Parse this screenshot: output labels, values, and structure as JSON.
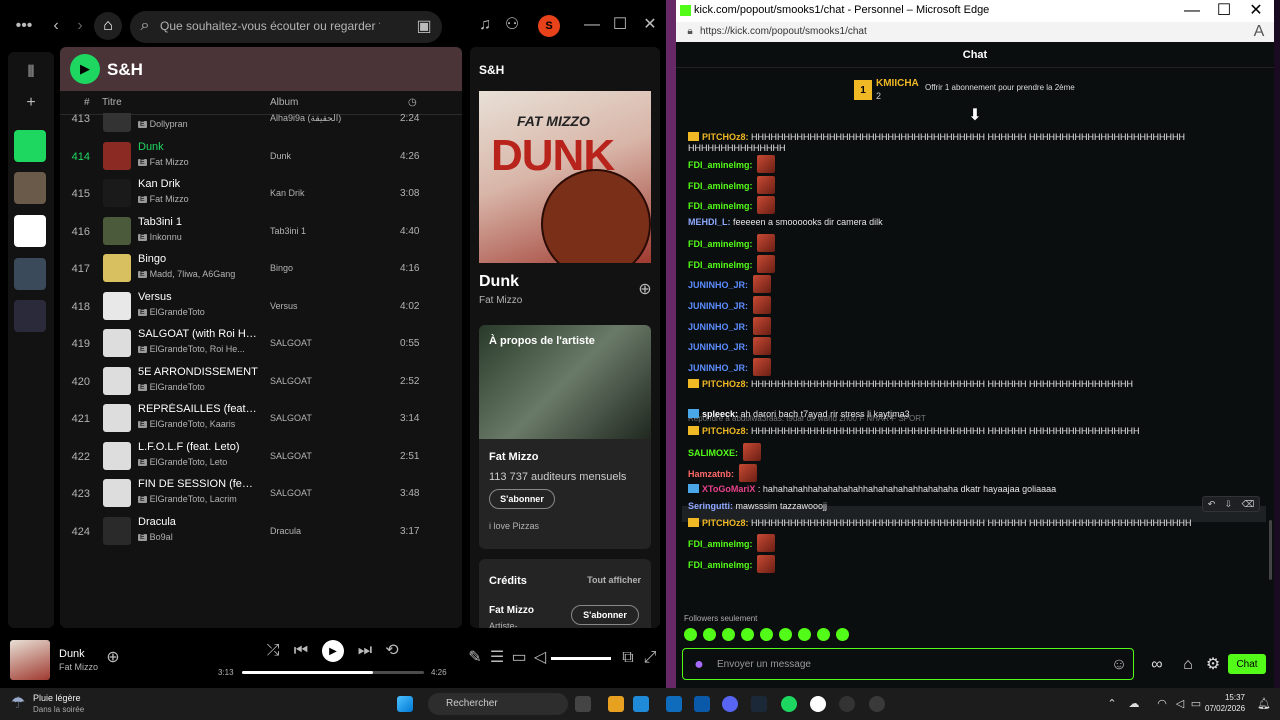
{
  "spotify": {
    "search_placeholder": "Que souhaitez-vous écouter ou regarder ?",
    "avatar_letter": "S",
    "playlist_name": "S&H",
    "columns": {
      "num": "#",
      "title": "Titre",
      "album": "Album"
    },
    "tracks": [
      {
        "num": "413",
        "title": "",
        "artist": "Dollypran",
        "album": "Alha9i9a (الحقيقة)",
        "duration": "2:24",
        "cover": "#333333"
      },
      {
        "num": "414",
        "title": "Dunk",
        "artist": "Fat Mizzo",
        "album": "Dunk",
        "duration": "4:26",
        "cover": "#8a2a22",
        "active": true
      },
      {
        "num": "415",
        "title": "Kan Drik",
        "artist": "Fat Mizzo",
        "album": "Kan Drik",
        "duration": "3:08",
        "cover": "#1a1a1a"
      },
      {
        "num": "416",
        "title": "Tab3ini 1",
        "artist": "Inkonnu",
        "album": "Tab3ini 1",
        "duration": "4:40",
        "cover": "#4a5a3a"
      },
      {
        "num": "417",
        "title": "Bingo",
        "artist": "Madd, 7liwa, A6Gang",
        "album": "Bingo",
        "duration": "4:16",
        "cover": "#d8c060"
      },
      {
        "num": "418",
        "title": "Versus",
        "artist": "ElGrandeToto",
        "album": "Versus",
        "duration": "4:02",
        "cover": "#e8e8e8"
      },
      {
        "num": "419",
        "title": "SALGOAT (with Roi He...",
        "artist": "ElGrandeToto, Roi He...",
        "album": "SALGOAT",
        "duration": "0:55",
        "cover": "#dddddd"
      },
      {
        "num": "420",
        "title": "5E ARRONDISSEMENT",
        "artist": "ElGrandeToto",
        "album": "SALGOAT",
        "duration": "2:52",
        "cover": "#dddddd"
      },
      {
        "num": "421",
        "title": "REPRÉSAILLES (feat. K...",
        "artist": "ElGrandeToto, Kaaris",
        "album": "SALGOAT",
        "duration": "3:14",
        "cover": "#dddddd"
      },
      {
        "num": "422",
        "title": "L.F.O.L.F (feat. Leto)",
        "artist": "ElGrandeToto, Leto",
        "album": "SALGOAT",
        "duration": "2:51",
        "cover": "#dddddd"
      },
      {
        "num": "423",
        "title": "FIN DE SESSION (feat. ...",
        "artist": "ElGrandeToto, Lacrim",
        "album": "SALGOAT",
        "duration": "3:48",
        "cover": "#dddddd"
      },
      {
        "num": "424",
        "title": "Dracula",
        "artist": "Bo9al",
        "album": "Dracula",
        "duration": "3:17",
        "cover": "#2a2a2a"
      }
    ],
    "explicit": "E",
    "now_playing_panel": {
      "title": "S&H",
      "cover_top": "FAT MIZZO",
      "cover_word": "DUNK",
      "song": "Dunk",
      "artist": "Fat Mizzo"
    },
    "about": {
      "heading": "À propos de l'artiste",
      "name": "Fat Mizzo",
      "listeners": "113 737 auditeurs mensuels",
      "follow": "S'abonner",
      "bio": "i love Pizzas"
    },
    "credits": {
      "heading": "Crédits",
      "show_all": "Tout afficher",
      "name": "Fat Mizzo",
      "role": "Artiste-",
      "follow": "S'abonner"
    },
    "player": {
      "title": "Dunk",
      "artist": "Fat Mizzo",
      "current": "3:13",
      "total": "4:26",
      "progress": 0.72,
      "volume": 1.0
    }
  },
  "edge": {
    "title": "kick.com/popout/smooks1/chat - Personnel – Microsoft Edge",
    "url": "https://kick.com/popout/smooks1/chat",
    "chat_title": "Chat",
    "gifter": {
      "rank": "1",
      "name": "KMIICHA",
      "count": "2",
      "offer": "Offrir 1 abonnement pour prendre la 2ème"
    },
    "messages": [
      {
        "user": "PITCHOz8:",
        "color": "#f0b825",
        "badge": "#f0b825",
        "text": "HHHHHHHHHHHHHHHHHHHHHHHHHHHHHHHHHHHH HHHHHH HHHHHHHHHHHHHHHHHHHHHHHH HHHHHHHHHHHHHHH"
      },
      {
        "user": "FDI_aminelmg:",
        "color": "#53fc18",
        "text": "",
        "emote": true
      },
      {
        "user": "FDI_aminelmg:",
        "color": "#53fc18",
        "text": "",
        "emote": true
      },
      {
        "user": "FDI_aminelmg:",
        "color": "#53fc18",
        "text": "",
        "emote": true
      },
      {
        "user": "MEHDI_L:",
        "color": "#8fa8ff",
        "text": "feeeeen a smoooooks dir camera dilk"
      },
      {
        "user": "FDI_aminelmg:",
        "color": "#53fc18",
        "text": "",
        "emote": true
      },
      {
        "user": "FDI_aminelmg:",
        "color": "#53fc18",
        "text": "",
        "emote": true
      },
      {
        "user": "JUNINHO_JR:",
        "color": "#5b8dff",
        "text": "",
        "emote": true
      },
      {
        "user": "JUNINHO_JR:",
        "color": "#5b8dff",
        "text": "",
        "emote": true
      },
      {
        "user": "JUNINHO_JR:",
        "color": "#5b8dff",
        "text": "",
        "emote": true
      },
      {
        "user": "JUNINHO_JR:",
        "color": "#5b8dff",
        "text": "",
        "emote": true
      },
      {
        "user": "JUNINHO_JR:",
        "color": "#5b8dff",
        "text": "",
        "emote": true
      },
      {
        "user": "PITCHOz8:",
        "color": "#f0b825",
        "badge": "#f0b825",
        "text": "HHHHHHHHHHHHHHHHHHHHHHHHHHHHHHHHHHHH HHHHHH HHHHHHHHHHHHHHHH"
      },
      {
        "user": "spleeck:",
        "color": "#ffffff",
        "badge": "#4aa8e8",
        "text": "ah darori bach t7ayad rir stress li kaytjma3"
      },
      {
        "user": "PITCHOz8:",
        "color": "#f0b825",
        "badge": "#f0b825",
        "text": "HHHHHHHHHHHHHHHHHHHHHHHHHHHHHHHHHHHH HHHHHH HHHHHHHHHHHHHHHHH"
      },
      {
        "user": "SALIMOXE:",
        "color": "#53fc18",
        "text": "",
        "emote": true
      },
      {
        "user": "Hamzatnb:",
        "color": "#ff6a6a",
        "text": "",
        "emote": true
      },
      {
        "user": "XToGoMariX",
        "color": "#e8428a",
        "badge": "#4aa8e8",
        "text": ": hahahahahhahahahahahhahahahahahhahahaha dkatr hayaajaa goliaaaa"
      },
      {
        "user": "Seringutti:",
        "color": "#8fa8ff",
        "text": "mawsssim tazzawooojj"
      },
      {
        "user": "PITCHOz8:",
        "color": "#f0b825",
        "badge": "#f0b825",
        "text": "HHHHHHHHHHHHHHHHHHHHHHHHHHHHHHHHHHHH HHHHHH HHHHHHHHHHHHHHHHHHHHHHHHH"
      },
      {
        "user": "FDI_aminelmg:",
        "color": "#53fc18",
        "text": "",
        "emote": true
      },
      {
        "user": "FDI_aminelmg:",
        "color": "#53fc18",
        "text": "",
        "emote": true
      }
    ],
    "reply_hint": "Répondre à abdolwa3raas: t9dar dir wahd 2h00 F NHAR F SPORT",
    "followers_only": "Followers seulement",
    "input_placeholder": "Envoyer un message",
    "send": "Chat"
  },
  "taskbar": {
    "weather_title": "Pluie légère",
    "weather_sub": "Dans la soirée",
    "search": "Rechercher",
    "time": "15:37",
    "date": "07/02/2026"
  }
}
